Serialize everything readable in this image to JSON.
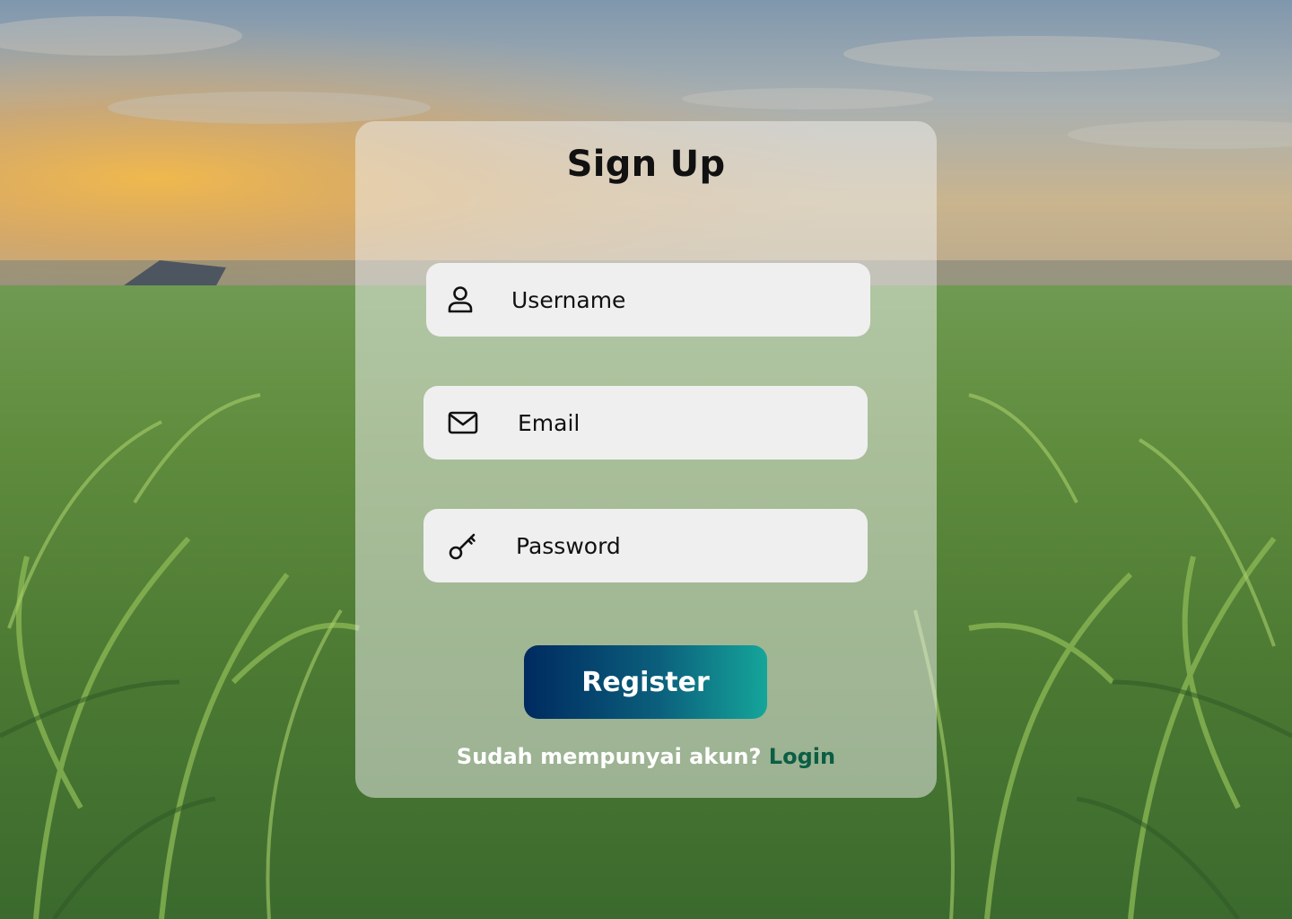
{
  "page": {
    "title": "Sign Up"
  },
  "form": {
    "username": {
      "placeholder": "Username",
      "value": "",
      "icon": "user-icon"
    },
    "email": {
      "placeholder": "Email",
      "value": "",
      "icon": "mail-icon"
    },
    "password": {
      "placeholder": "Password",
      "value": "",
      "icon": "key-icon"
    }
  },
  "actions": {
    "register_label": "Register"
  },
  "footer": {
    "question": "Sudah mempunyai akun?",
    "login_label": "Login"
  },
  "colors": {
    "button_gradient_start": "#002a60",
    "button_gradient_end": "#15a59a",
    "login_link": "#0b5e44",
    "card": "#eeeeee",
    "field": "#efefef"
  }
}
